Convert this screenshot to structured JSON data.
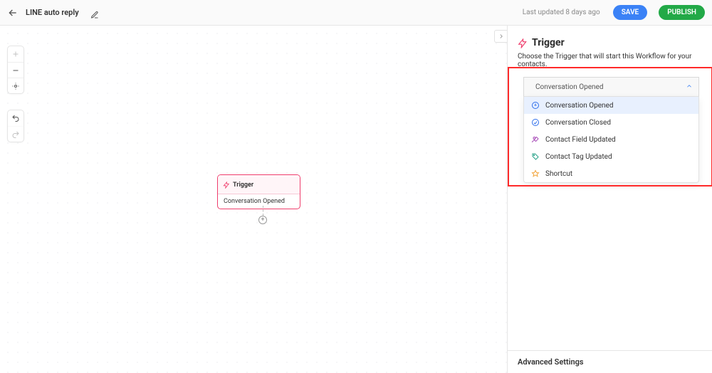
{
  "header": {
    "title": "LINE auto reply",
    "updated": "Last updated 8 days ago",
    "save_label": "SAVE",
    "publish_label": "PUBLISH"
  },
  "canvas": {
    "node_title": "Trigger",
    "node_value": "Conversation Opened"
  },
  "panel": {
    "title": "Trigger",
    "description": "Choose the Trigger that will start this Workflow for your contacts.",
    "selected": "Conversation Opened",
    "options": [
      {
        "label": "Conversation Opened",
        "icon": "conversation-opened-icon",
        "color": "ico-blue"
      },
      {
        "label": "Conversation Closed",
        "icon": "conversation-closed-icon",
        "color": "ico-blue"
      },
      {
        "label": "Contact Field Updated",
        "icon": "contact-field-icon",
        "color": "ico-purple"
      },
      {
        "label": "Contact Tag Updated",
        "icon": "contact-tag-icon",
        "color": "ico-teal"
      },
      {
        "label": "Shortcut",
        "icon": "shortcut-icon",
        "color": "ico-orange"
      }
    ],
    "advanced_label": "Advanced Settings"
  }
}
